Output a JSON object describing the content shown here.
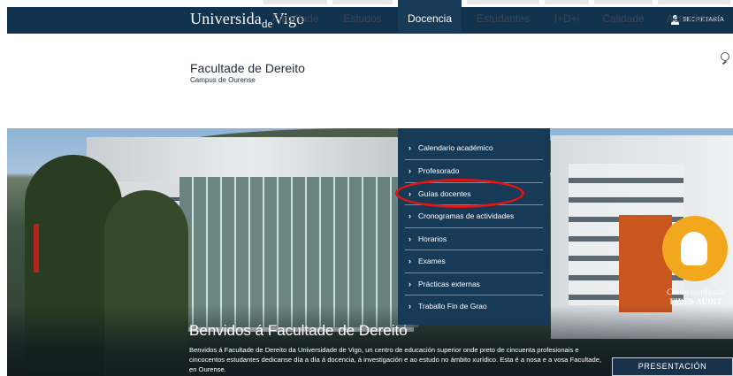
{
  "topbar": {
    "brand_main": "Universida",
    "brand_de": "de",
    "brand_end": "Vigo",
    "secretaria": "SECRETARÍA"
  },
  "header": {
    "title": "Facultade de Dereito",
    "subtitle": "Campus de Ourense"
  },
  "nav": {
    "items": [
      {
        "label": "Facultade"
      },
      {
        "label": "Estudos"
      },
      {
        "label": "Docencia"
      },
      {
        "label": "Estudantes"
      },
      {
        "label": "I+D+i"
      },
      {
        "label": "Calidade"
      },
      {
        "label": "Actualidade"
      }
    ],
    "active": "Docencia"
  },
  "dropdown": {
    "items": [
      {
        "label": "Calendario académico"
      },
      {
        "label": "Profesorado"
      },
      {
        "label": "Guías docentes"
      },
      {
        "label": "Cronogramas de actividades"
      },
      {
        "label": "Horarios"
      },
      {
        "label": "Exames"
      },
      {
        "label": "Prácticas externas"
      },
      {
        "label": "Traballo Fin de Grao"
      }
    ],
    "highlighted": "Guías docentes"
  },
  "hero": {
    "title": "Benvidos á Facultade de Dereito",
    "text": "Benvidos á Facultade de Dereito da Universidade de Vigo, un centro de educación superior onde preto de cincuenta profesionais e cincocentos estudantes dedicanse día a día á docencia, á investigación e ao estudo no ámbito xurídico. Esta é a nosa e a vosa Facultade, en Ourense.",
    "button": "PRESENTACIÓN"
  },
  "badge": {
    "line1": "Centro certificado",
    "line2": "FIDES-AUDIT"
  },
  "colors": {
    "primary": "#173a57",
    "topbar": "#12334e",
    "highlight_ring": "#e11414",
    "badge": "#f2a81d"
  }
}
